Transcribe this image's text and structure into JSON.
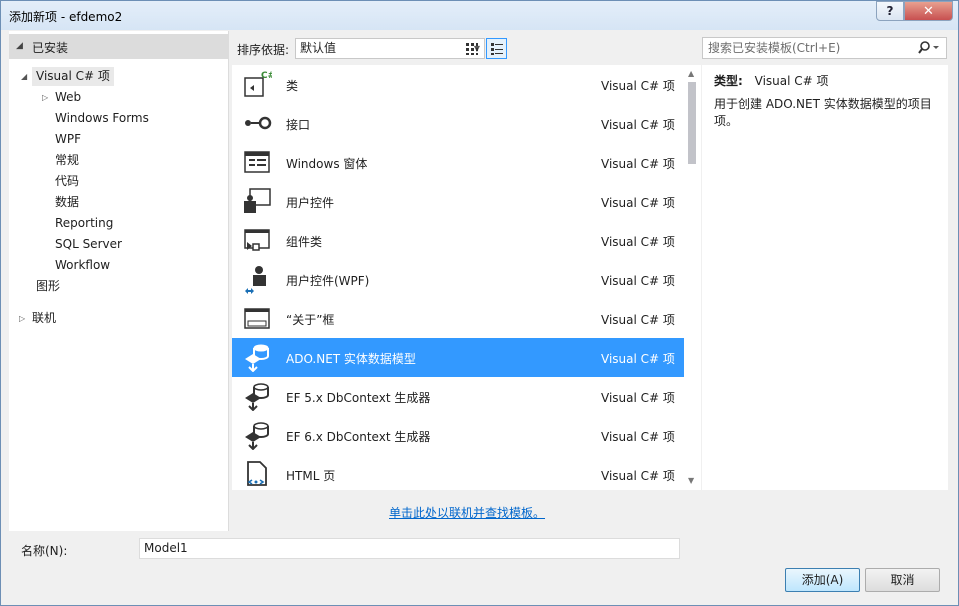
{
  "window": {
    "title": "添加新项 - efdemo2",
    "help_label": "?",
    "close_label": "✕"
  },
  "left_tree": {
    "installed_label": "已安装",
    "root_label": "Visual C# 项",
    "items": [
      "Web",
      "Windows Forms",
      "WPF",
      "常规",
      "代码",
      "数据",
      "Reporting",
      "SQL Server",
      "Workflow"
    ],
    "graphics_label": "图形",
    "online_label": "联机"
  },
  "toolbar": {
    "sort_label": "排序依据:",
    "sort_value": "默认值"
  },
  "search": {
    "placeholder": "搜索已安装模板(Ctrl+E)"
  },
  "templates": [
    {
      "name": "类",
      "category": "Visual C# 项",
      "icon": "class-icon"
    },
    {
      "name": "接口",
      "category": "Visual C# 项",
      "icon": "interface-icon"
    },
    {
      "name": "Windows 窗体",
      "category": "Visual C# 项",
      "icon": "windows-form-icon"
    },
    {
      "name": "用户控件",
      "category": "Visual C# 项",
      "icon": "user-control-icon"
    },
    {
      "name": "组件类",
      "category": "Visual C# 项",
      "icon": "component-class-icon"
    },
    {
      "name": "用户控件(WPF)",
      "category": "Visual C# 项",
      "icon": "wpf-user-control-icon"
    },
    {
      "name": "“关于”框",
      "category": "Visual C# 项",
      "icon": "about-box-icon"
    },
    {
      "name": "ADO.NET 实体数据模型",
      "category": "Visual C# 项",
      "icon": "entity-model-icon",
      "selected": true
    },
    {
      "name": "EF 5.x DbContext 生成器",
      "category": "Visual C# 项",
      "icon": "dbcontext-generator-icon"
    },
    {
      "name": "EF 6.x DbContext 生成器",
      "category": "Visual C# 项",
      "icon": "dbcontext-generator-icon"
    },
    {
      "name": "HTML 页",
      "category": "Visual C# 项",
      "icon": "html-page-icon"
    }
  ],
  "detail": {
    "type_label": "类型:",
    "type_value": "Visual C# 项",
    "description": "用于创建 ADO.NET 实体数据模型的项目项。"
  },
  "online_link": "单击此处以联机并查找模板。",
  "name_field": {
    "label": "名称(N):",
    "value": "Model1"
  },
  "buttons": {
    "add": "添加(A)",
    "cancel": "取消"
  },
  "colors": {
    "selection": "#3399ff",
    "link": "#0066cc"
  }
}
